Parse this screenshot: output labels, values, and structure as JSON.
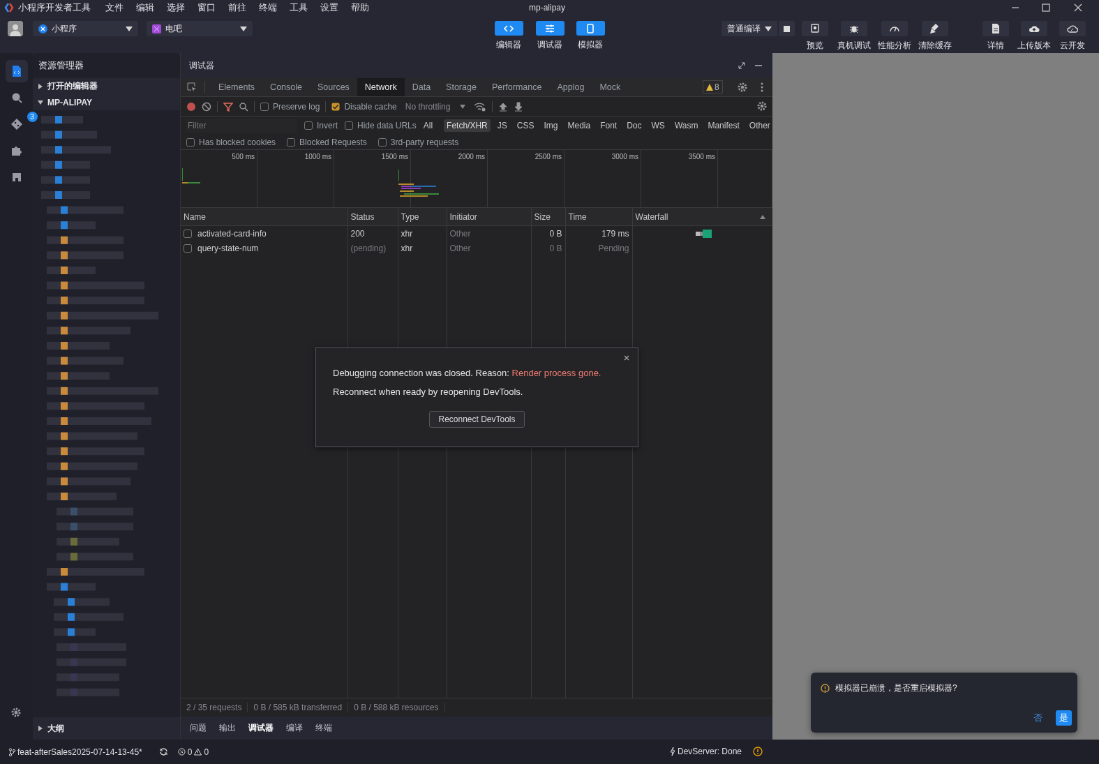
{
  "title_bar": {
    "app_name": "小程序开发者工具",
    "menus": [
      "文件",
      "编辑",
      "选择",
      "窗口",
      "前往",
      "终端",
      "工具",
      "设置",
      "帮助"
    ],
    "title": "mp-alipay"
  },
  "toolbar": {
    "project_type": "小程序",
    "project": "电吧",
    "view_toggles": [
      {
        "label": "编辑器",
        "on": true
      },
      {
        "label": "调试器",
        "on": true
      },
      {
        "label": "模拟器",
        "on": true
      }
    ],
    "compile_mode": "普通编译",
    "actions": [
      {
        "label": "预览"
      },
      {
        "label": "真机调试"
      },
      {
        "label": "性能分析"
      },
      {
        "label": "清除缓存"
      },
      {
        "label": "详情"
      },
      {
        "label": "上传版本"
      },
      {
        "label": "云开发"
      }
    ]
  },
  "activity_bar": {
    "items": [
      {
        "selected": true
      },
      {
        "selected": false
      },
      {
        "selected": false,
        "badge": "3"
      },
      {
        "selected": false
      },
      {
        "selected": false
      }
    ]
  },
  "explorer": {
    "title": "资源管理器",
    "sections": [
      {
        "label": "打开的编辑器",
        "expanded": false
      },
      {
        "label": "MP-ALIPAY",
        "expanded": true
      }
    ],
    "outline": {
      "label": "大纲",
      "expanded": false
    }
  },
  "devtools": {
    "title": "调试器",
    "tabs": [
      {
        "label": "Elements",
        "selected": false
      },
      {
        "label": "Console",
        "selected": false
      },
      {
        "label": "Sources",
        "selected": false
      },
      {
        "label": "Network",
        "selected": true
      },
      {
        "label": "Data",
        "selected": false
      },
      {
        "label": "Storage",
        "selected": false
      },
      {
        "label": "Performance",
        "selected": false
      },
      {
        "label": "Applog",
        "selected": false
      },
      {
        "label": "Mock",
        "selected": false
      }
    ],
    "warning_count": "8",
    "network_toolbar": {
      "preserve_log": {
        "label": "Preserve log",
        "checked": false
      },
      "disable_cache": {
        "label": "Disable cache",
        "checked": true
      },
      "throttling": "No throttling"
    },
    "filter": {
      "placeholder": "Filter",
      "invert": {
        "label": "Invert",
        "checked": false
      },
      "hide_data_urls": {
        "label": "Hide data URLs",
        "checked": false
      },
      "types": [
        {
          "label": "All",
          "selected": false
        },
        {
          "label": "Fetch/XHR",
          "selected": true
        },
        {
          "label": "JS",
          "selected": false
        },
        {
          "label": "CSS",
          "selected": false
        },
        {
          "label": "Img",
          "selected": false
        },
        {
          "label": "Media",
          "selected": false
        },
        {
          "label": "Font",
          "selected": false
        },
        {
          "label": "Doc",
          "selected": false
        },
        {
          "label": "WS",
          "selected": false
        },
        {
          "label": "Wasm",
          "selected": false
        },
        {
          "label": "Manifest",
          "selected": false
        },
        {
          "label": "Other",
          "selected": false
        }
      ]
    },
    "options": [
      {
        "label": "Has blocked cookies",
        "checked": false
      },
      {
        "label": "Blocked Requests",
        "checked": false
      },
      {
        "label": "3rd-party requests",
        "checked": false
      }
    ],
    "overview_ticks": [
      "500 ms",
      "1000 ms",
      "1500 ms",
      "2000 ms",
      "2500 ms",
      "3000 ms",
      "3500 ms"
    ],
    "table": {
      "columns": [
        "Name",
        "Status",
        "Type",
        "Initiator",
        "Size",
        "Time",
        "Waterfall"
      ],
      "rows": [
        {
          "name": "activated-card-info",
          "status": "200",
          "type": "xhr",
          "initiator": "Other",
          "size": "0 B",
          "time": "179 ms",
          "pending": false,
          "checked": false
        },
        {
          "name": "query-state-num",
          "status": "(pending)",
          "type": "xhr",
          "initiator": "Other",
          "size": "0 B",
          "time": "Pending",
          "pending": true,
          "checked": false
        }
      ]
    },
    "summary": [
      "2 / 35 requests",
      "0 B / 585 kB transferred",
      "0 B / 588 kB resources"
    ],
    "dialog": {
      "message": "Debugging connection was closed. Reason: ",
      "reason": "Render process gone.",
      "hint": "Reconnect when ready by reopening DevTools.",
      "button": "Reconnect DevTools"
    },
    "bottom_tabs": [
      {
        "label": "问题",
        "selected": false
      },
      {
        "label": "输出",
        "selected": false
      },
      {
        "label": "调试器",
        "selected": true
      },
      {
        "label": "编译",
        "selected": false
      },
      {
        "label": "终端",
        "selected": false
      }
    ]
  },
  "toast": {
    "message": "模拟器已崩溃，是否重启模拟器?",
    "buttons": [
      {
        "label": "否",
        "primary": false
      },
      {
        "label": "是",
        "primary": true
      }
    ]
  },
  "status_bar": {
    "branch": "feat-afterSales2025-07-14-13-45*",
    "errors": "0",
    "warnings": "0",
    "dev_server": "DevServer: Done"
  }
}
